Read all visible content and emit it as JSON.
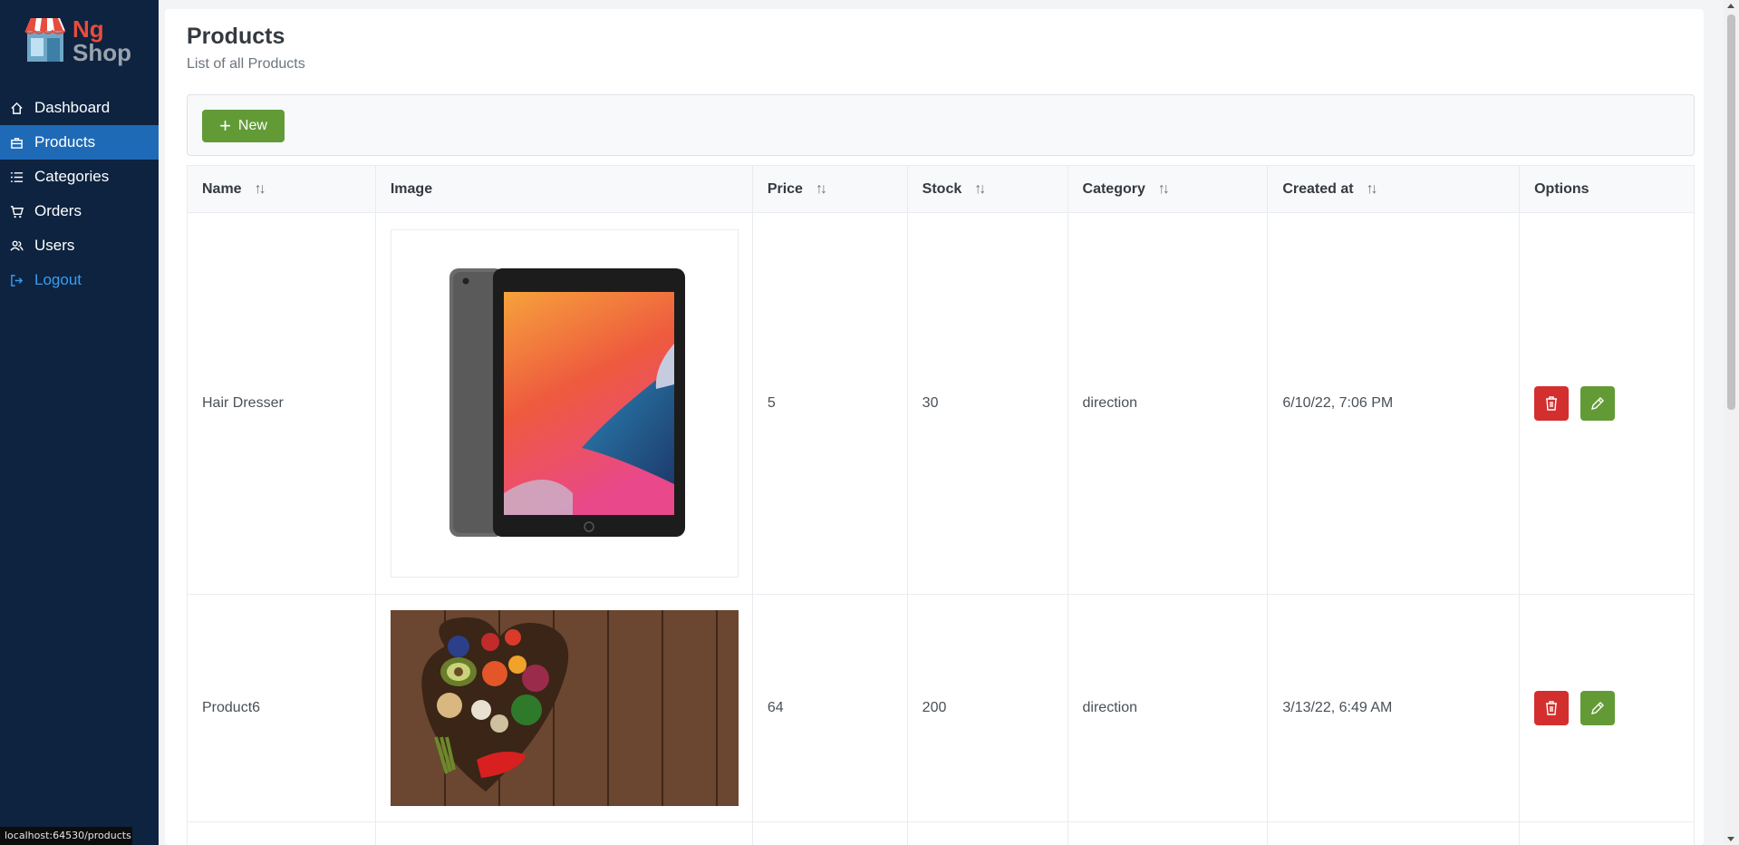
{
  "brand": {
    "line1": "Ng",
    "line2": "Shop",
    "color_ng": "#e74c3c",
    "color_shop": "#9aa3ad"
  },
  "sidebar": {
    "items": [
      {
        "label": "Dashboard",
        "icon": "home-icon"
      },
      {
        "label": "Products",
        "icon": "briefcase-icon",
        "active": true
      },
      {
        "label": "Categories",
        "icon": "list-icon"
      },
      {
        "label": "Orders",
        "icon": "shopping-cart-icon"
      },
      {
        "label": "Users",
        "icon": "users-icon"
      },
      {
        "label": "Logout",
        "icon": "sign-out-icon"
      }
    ]
  },
  "header": {
    "title": "Products",
    "subtitle": "List of all Products"
  },
  "toolbar": {
    "new_label": "New"
  },
  "table": {
    "columns": [
      "Name",
      "Image",
      "Price",
      "Stock",
      "Category",
      "Created at",
      "Options"
    ],
    "rows": [
      {
        "name": "Hair Dresser",
        "image": "tablet-image",
        "price": "5",
        "stock": "30",
        "category": "direction",
        "created": "6/10/22, 7:06 PM"
      },
      {
        "name": "Product6",
        "image": "vegetables-heart-image",
        "price": "64",
        "stock": "200",
        "category": "direction",
        "created": "3/13/22, 6:49 AM"
      }
    ]
  },
  "statusbar": {
    "url": "localhost:64530/products"
  },
  "colors": {
    "sidebar_bg": "#0d2340",
    "active": "#1f6ab7",
    "success": "#629b36",
    "danger": "#d32f2f",
    "link": "#3b9cf0"
  }
}
